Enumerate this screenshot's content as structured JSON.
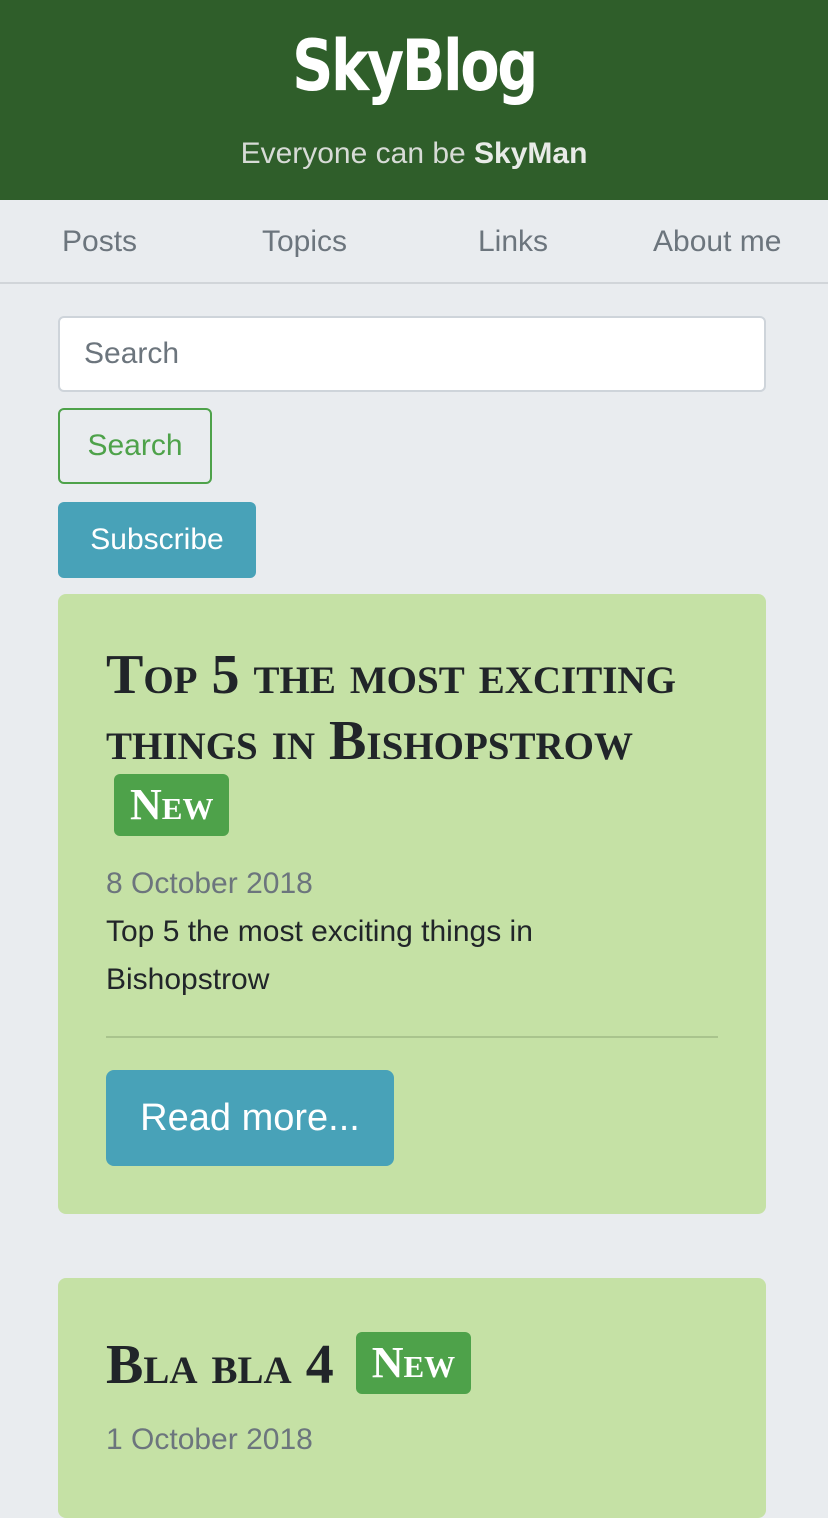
{
  "header": {
    "brand": "SkyBlog",
    "tagline_prefix": "Everyone can be ",
    "tagline_name": "SkyMan"
  },
  "nav": {
    "items": [
      {
        "label": "Posts"
      },
      {
        "label": "Topics"
      },
      {
        "label": "Links"
      },
      {
        "label": "About me"
      }
    ]
  },
  "search": {
    "placeholder": "Search",
    "button_label": "Search"
  },
  "subscribe_label": "Subscribe",
  "posts": [
    {
      "title": "Top 5 the most exciting things in Bishopstrow",
      "badge": "New",
      "date": "8 October 2018",
      "excerpt": "Top 5 the most exciting things in Bishopstrow",
      "read_more": "Read more..."
    },
    {
      "title": "Bla bla 4",
      "badge": "New",
      "date": "1 October 2018"
    }
  ],
  "colors": {
    "header_bg": "#2f5e2a",
    "card_bg": "#c5e1a5",
    "badge_bg": "#4ea24a",
    "button_info": "#48a2b8"
  }
}
